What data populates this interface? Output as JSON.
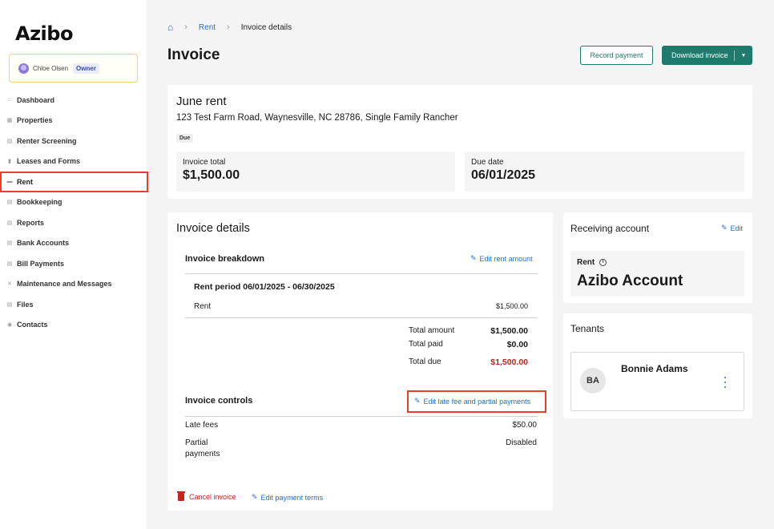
{
  "app": {
    "logo": "Azibo"
  },
  "user": {
    "name": "Chloe Olsen",
    "role": "Owner"
  },
  "nav": [
    {
      "label": "Dashboard",
      "icon": "home-icon"
    },
    {
      "label": "Properties",
      "icon": "building-icon"
    },
    {
      "label": "Renter Screening",
      "icon": "clipboard-icon"
    },
    {
      "label": "Leases and Forms",
      "icon": "document-icon"
    },
    {
      "label": "Rent",
      "icon": "money-icon",
      "active": true
    },
    {
      "label": "Bookkeeping",
      "icon": "ledger-icon"
    },
    {
      "label": "Reports",
      "icon": "report-icon"
    },
    {
      "label": "Bank Accounts",
      "icon": "bank-icon"
    },
    {
      "label": "Bill Payments",
      "icon": "bill-icon"
    },
    {
      "label": "Maintenance and Messages",
      "icon": "wrench-icon"
    },
    {
      "label": "Files",
      "icon": "folder-icon"
    },
    {
      "label": "Contacts",
      "icon": "contact-icon"
    }
  ],
  "breadcrumb": {
    "home_icon": "home-icon",
    "rent": "Rent",
    "current": "Invoice details"
  },
  "header": {
    "title": "Invoice",
    "record_payment": "Record payment",
    "download_invoice": "Download invoice"
  },
  "summary": {
    "title": "June rent",
    "address": "123 Test Farm Road, Waynesville, NC 28786, Single Family Rancher",
    "status": "Due",
    "invoice_total_label": "Invoice total",
    "invoice_total": "$1,500.00",
    "due_date_label": "Due date",
    "due_date": "06/01/2025"
  },
  "details": {
    "title": "Invoice details",
    "breakdown_title": "Invoice breakdown",
    "edit_rent_amount": "Edit rent amount",
    "rent_period": "Rent period 06/01/2025 - 06/30/2025",
    "rent_label": "Rent",
    "rent_amount": "$1,500.00",
    "total_amount_label": "Total amount",
    "total_amount": "$1,500.00",
    "total_paid_label": "Total paid",
    "total_paid": "$0.00",
    "total_due_label": "Total due",
    "total_due": "$1,500.00",
    "controls_title": "Invoice controls",
    "edit_late_fee": "Edit late fee and partial payments",
    "late_fees_label": "Late fees",
    "late_fees": "$50.00",
    "partial_label_1": "Partial",
    "partial_label_2": "payments",
    "partial_value": "Disabled",
    "cancel_invoice": "Cancel invoice",
    "edit_payment_terms": "Edit payment terms"
  },
  "receiving": {
    "title": "Receiving account",
    "edit": "Edit",
    "label": "Rent",
    "account": "Azibo Account"
  },
  "tenants": {
    "title": "Tenants",
    "items": [
      {
        "initials": "BA",
        "name": "Bonnie Adams"
      }
    ]
  },
  "colors": {
    "brand": "#1e7a6a",
    "link": "#1e6fd9",
    "danger": "#c4261d",
    "highlight": "#e8402a"
  }
}
